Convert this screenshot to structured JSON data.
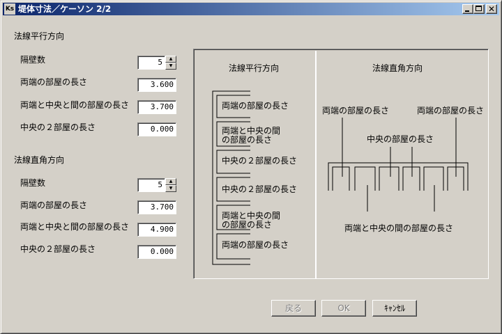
{
  "window": {
    "title": "堤体寸法／ケーソン 2/2",
    "app_icon": "Ks",
    "controls": {
      "minimize": "minimize-icon",
      "maximize": "maximize-icon",
      "close": "close-icon"
    }
  },
  "parallel": {
    "heading": "法線平行方向",
    "bulkhead_label": "隔壁数",
    "bulkhead_value": "5",
    "end_room_label": "両端の部屋の長さ",
    "end_room_value": "3.600",
    "mid_room_label": "両端と中央と間の部屋の長さ",
    "mid_room_value": "3.700",
    "center_room_label": "中央の２部屋の長さ",
    "center_room_value": "0.000"
  },
  "perpendicular": {
    "heading": "法線直角方向",
    "bulkhead_label": "隔壁数",
    "bulkhead_value": "5",
    "end_room_label": "両端の部屋の長さ",
    "end_room_value": "3.700",
    "mid_room_label": "両端と中央と間の部屋の長さ",
    "mid_room_value": "4.900",
    "center_room_label": "中央の２部屋の長さ",
    "center_room_value": "0.000"
  },
  "diagram": {
    "parallel_title": "法線平行方向",
    "perpendicular_title": "法線直角方向",
    "parallel_rooms": [
      "両端の部屋の長さ",
      "両端と中央の間",
      "の部屋の長さ",
      "中央の２部屋の長さ",
      "中央の２部屋の長さ",
      "両端と中央の間",
      "の部屋の長さ",
      "両端の部屋の長さ"
    ],
    "perp_end_left": "両端の部屋の長さ",
    "perp_end_right": "両端の部屋の長さ",
    "perp_center": "中央の部屋の長さ",
    "perp_mid": "両端と中央の間の部屋の長さ"
  },
  "buttons": {
    "back": "戻る",
    "ok": "OK",
    "cancel": "ｷｬﾝｾﾙ"
  },
  "colors": {
    "window_bg": "#d4d0c8",
    "title_start": "#0a246a",
    "title_end": "#a6caf0"
  }
}
